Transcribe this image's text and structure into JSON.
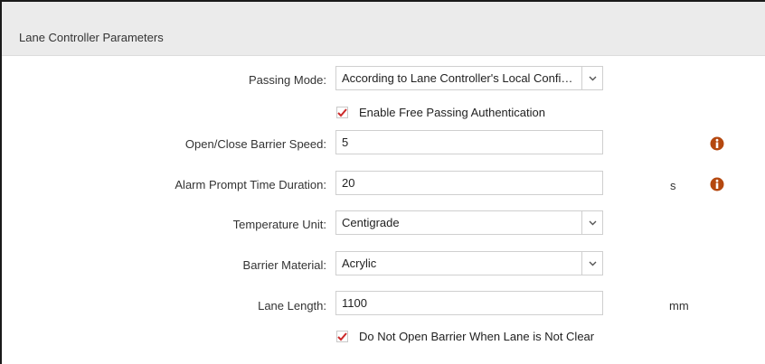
{
  "section": {
    "title": "Lane Controller Parameters"
  },
  "fields": {
    "passing_mode": {
      "label": "Passing Mode:",
      "value": "According to Lane Controller's Local Configuration"
    },
    "enable_free_passing": {
      "label": "Enable Free Passing Authentication",
      "checked": true
    },
    "barrier_speed": {
      "label": "Open/Close Barrier Speed:",
      "value": "5"
    },
    "alarm_duration": {
      "label": "Alarm Prompt Time Duration:",
      "value": "20",
      "unit": "s"
    },
    "temperature_unit": {
      "label": "Temperature Unit:",
      "value": "Centigrade"
    },
    "barrier_material": {
      "label": "Barrier Material:",
      "value": "Acrylic"
    },
    "lane_length": {
      "label": "Lane Length:",
      "value": "1100",
      "unit": "mm"
    },
    "not_open_barrier": {
      "label": "Do Not Open Barrier When Lane is Not Clear",
      "checked": true
    }
  },
  "icons": {
    "info": "info-icon",
    "dropdown": "chevron-down-icon",
    "check": "checkmark-icon"
  },
  "colors": {
    "info": "#b5480f",
    "check": "#cc2a2a",
    "header_bg": "#ebebeb"
  }
}
